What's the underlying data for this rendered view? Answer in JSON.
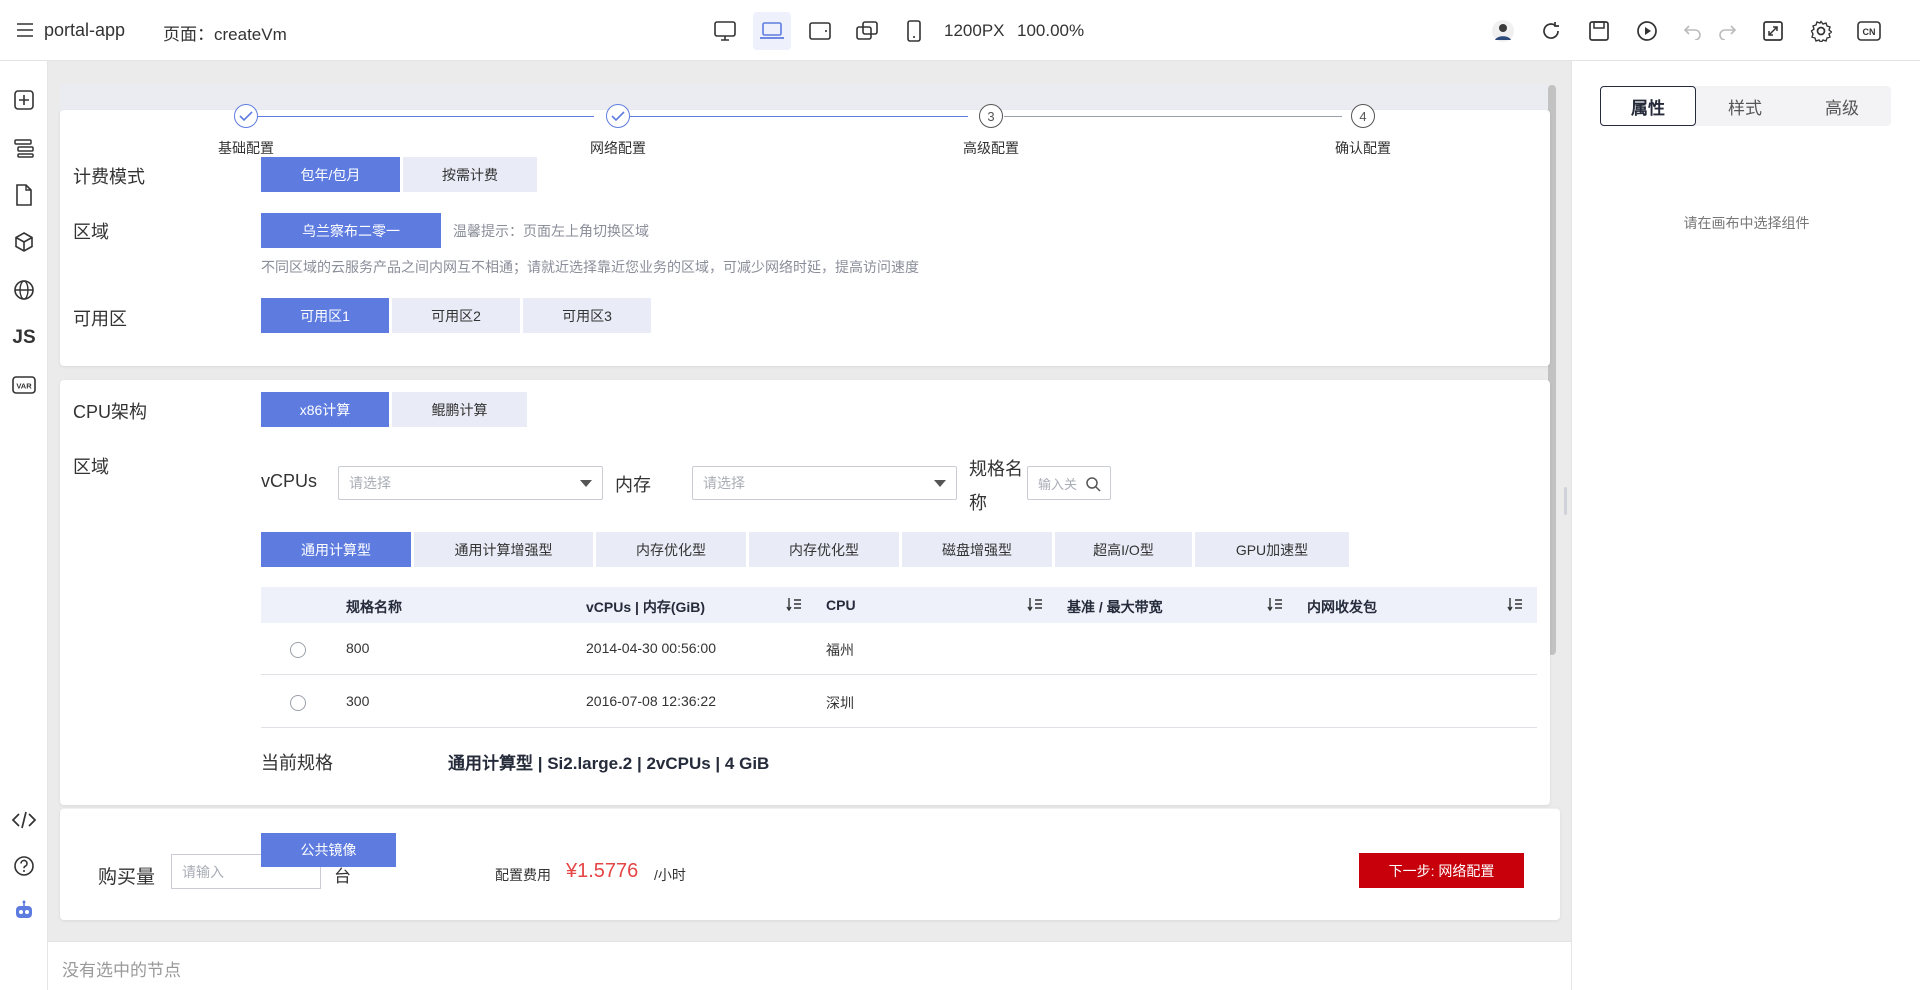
{
  "topbar": {
    "app_name": "portal-app",
    "page_label": "页面：createVm",
    "canvas_width": "1200PX",
    "zoom": "100.00%",
    "lang": "CN"
  },
  "stepper": {
    "steps": [
      {
        "label": "基础配置",
        "state": "done"
      },
      {
        "label": "网络配置",
        "state": "done"
      },
      {
        "label": "高级配置",
        "state": "todo",
        "num": "3"
      },
      {
        "label": "确认配置",
        "state": "todo",
        "num": "4"
      }
    ]
  },
  "basic": {
    "billing_label": "计费模式",
    "billing_options": [
      "包年/包月",
      "按需计费"
    ],
    "region_label": "区域",
    "region_value": "乌兰察布二零一",
    "region_tip": "温馨提示：页面左上角切换区域",
    "region_note": "不同区域的云服务产品之间内网互不相通；请就近选择靠近您业务的区域，可减少网络时延，提高访问速度",
    "zone_label": "可用区",
    "zone_options": [
      "可用区1",
      "可用区2",
      "可用区3"
    ]
  },
  "spec": {
    "cpu_arch_label": "CPU架构",
    "cpu_arch_options": [
      "x86计算",
      "鲲鹏计算"
    ],
    "region_label": "区域",
    "vcpus_label": "vCPUs",
    "vcpus_placeholder": "请选择",
    "memory_label": "内存",
    "memory_placeholder": "请选择",
    "name_label": "规格名称",
    "name_placeholder": "输入关",
    "type_tabs": [
      "通用计算型",
      "通用计算增强型",
      "内存优化型",
      "内存优化型",
      "磁盘增强型",
      "超高I/O型",
      "GPU加速型"
    ],
    "table": {
      "columns": [
        "规格名称",
        "vCPUs | 内存(GiB)",
        "CPU",
        "基准 / 最大带宽",
        "内网收发包"
      ],
      "rows": [
        {
          "name": "800",
          "vcpus_mem": "2014-04-30 00:56:00",
          "cpu": "福州"
        },
        {
          "name": "300",
          "vcpus_mem": "2016-07-08 12:36:22",
          "cpu": "深圳"
        }
      ]
    },
    "current_label": "当前规格",
    "current_value": "通用计算型 | Si2.large.2 | 2vCPUs | 4 GiB"
  },
  "footer": {
    "buy_label": "购买量",
    "buy_placeholder": "请输入",
    "buy_unit": "台",
    "mirror_button": "公共镜像",
    "fee_label": "配置费用",
    "fee_value": "¥1.5776",
    "fee_unit": "/小时",
    "next_button": "下一步: 网络配置"
  },
  "statusbar": {
    "text": "没有选中的节点"
  },
  "rightpanel": {
    "tabs": [
      "属性",
      "样式",
      "高级"
    ],
    "empty_tip": "请在画布中选择组件"
  },
  "colors": {
    "primary": "#5e7ce0",
    "danger": "#c7000b",
    "price": "#e54545"
  }
}
